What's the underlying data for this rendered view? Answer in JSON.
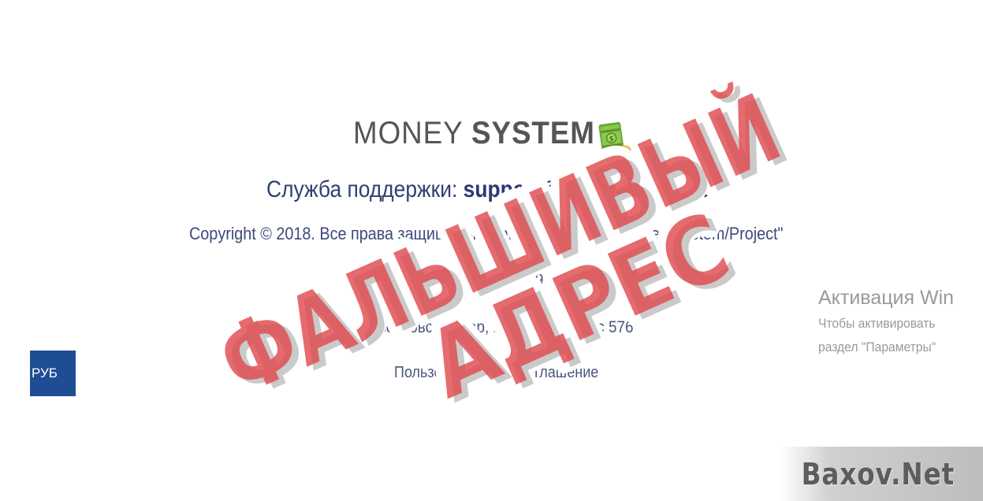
{
  "footer": {
    "logo_light": "MONEY ",
    "logo_bold": "SYSTEM",
    "logo_icon": "money-stack-icon",
    "support_label": "Служба поддержки: ",
    "support_email": "support@virtualclub.info",
    "copyright": "Copyright © 2018. Все права защищены. Startup Company: \"Money-System/Project\"",
    "city": "Санкт-Петербург, 190000",
    "address": "1-й Озерковский пер, корпус 25, офис 576",
    "agreement_link": "Пользовательское соглашение"
  },
  "currency_button": {
    "label": "РУБ",
    "color": "#1f4d94"
  },
  "windows_activation": {
    "title": "Активация Wind",
    "line1": "Чтобы активировать",
    "line2": "раздел \"Параметры\""
  },
  "stamp": {
    "line1": "ФАЛЬШИВЫЙ",
    "line2": "АДРЕС",
    "color": "#e04b50"
  },
  "watermark": {
    "text": "Baxov.Net"
  }
}
